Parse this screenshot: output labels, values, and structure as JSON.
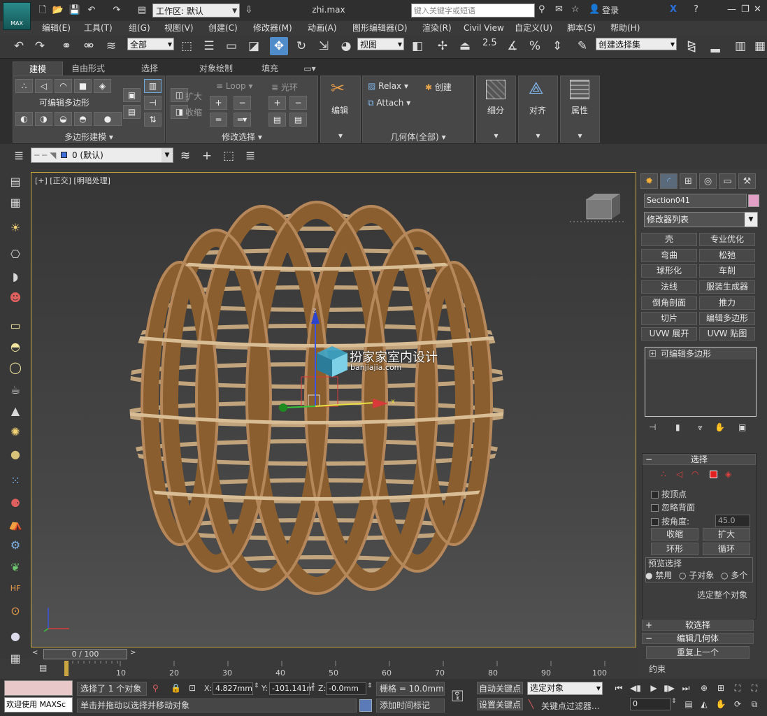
{
  "app": {
    "logo_text": "MAX",
    "workspace_label": "工作区: 默认",
    "filename": "zhi.max",
    "search_placeholder": "键入关键字或短语",
    "login": "登录"
  },
  "menus": [
    "编辑(E)",
    "工具(T)",
    "组(G)",
    "视图(V)",
    "创建(C)",
    "修改器(M)",
    "动画(A)",
    "图形编辑器(D)",
    "渲染(R)",
    "Civil View",
    "自定义(U)",
    "脚本(S)",
    "帮助(H)"
  ],
  "toolbar": {
    "filter": "全部",
    "refcoord": "视图",
    "snap_value": "2.5",
    "selset": "创建选择集"
  },
  "ribbon": {
    "tabs": [
      "建模",
      "自由形式",
      "选择",
      "对象绘制",
      "填充"
    ],
    "active_tab": "建模",
    "editable_poly": "可编辑多边形",
    "poly_modeling": "多边形建模",
    "modify_selection": "修改选择",
    "grow": "扩大",
    "shrink": "收缩",
    "loop": "Loop",
    "ring": "光环",
    "edit": "编辑",
    "relax": "Relax",
    "create": "创建",
    "attach": "Attach",
    "geometry_all": "几何体(全部)",
    "subdivision": "细分",
    "align": "对齐",
    "properties": "属性"
  },
  "layer": {
    "current": "0 (默认)"
  },
  "viewport": {
    "label": "[+] [正交] [明暗处理]",
    "watermark_title": "扮家家室内设计",
    "watermark_url": "banjiajia.com",
    "axis_x": "x",
    "axis_y": "y",
    "axis_z": "z"
  },
  "command_panel": {
    "object_name": "Section041",
    "object_color": "#e2a0c6",
    "modifier_list": "修改器列表",
    "modifier_buttons": [
      "壳",
      "专业优化",
      "弯曲",
      "松弛",
      "球形化",
      "车削",
      "法线",
      "服装生成器",
      "倒角剖面",
      "推力",
      "切片",
      "编辑多边形",
      "UVW 展开",
      "UVW 贴图"
    ],
    "stack_item": "可编辑多边形",
    "selection": {
      "title": "选择",
      "by_vertex": "按顶点",
      "ignore_backfacing": "忽略背面",
      "by_angle": "按角度:",
      "angle_value": "45.0",
      "shrink": "收缩",
      "grow": "扩大",
      "ring": "环形",
      "loop": "循环",
      "preview": "预览选择",
      "preview_off": "禁用",
      "preview_sub": "子对象",
      "preview_multi": "多个",
      "whole_object": "选定整个对象"
    },
    "soft_selection": "软选择",
    "edit_geometry": "编辑几何体",
    "repeat_last": "重复上一个",
    "constraints": "约束"
  },
  "timeline": {
    "frame": "0 / 100",
    "ticks": [
      "10",
      "20",
      "30",
      "40",
      "50",
      "60",
      "70",
      "80",
      "90",
      "100"
    ]
  },
  "status": {
    "welcome": "欢迎使用 MAXSc",
    "selected": "选择了 1 个对象",
    "hint": "单击并拖动以选择并移动对象",
    "x_label": "X:",
    "x_value": "4.827mm",
    "y_label": "Y:",
    "y_value": "-101.141m",
    "z_label": "Z:",
    "z_value": "-0.0mm",
    "grid": "栅格 = 10.0mm",
    "add_tag": "添加时间标记",
    "autokey": "自动关键点",
    "setkey": "设置关键点",
    "selected_obj": "选定对象",
    "key_filter": "关键点过滤器...",
    "frame_field": "0"
  }
}
